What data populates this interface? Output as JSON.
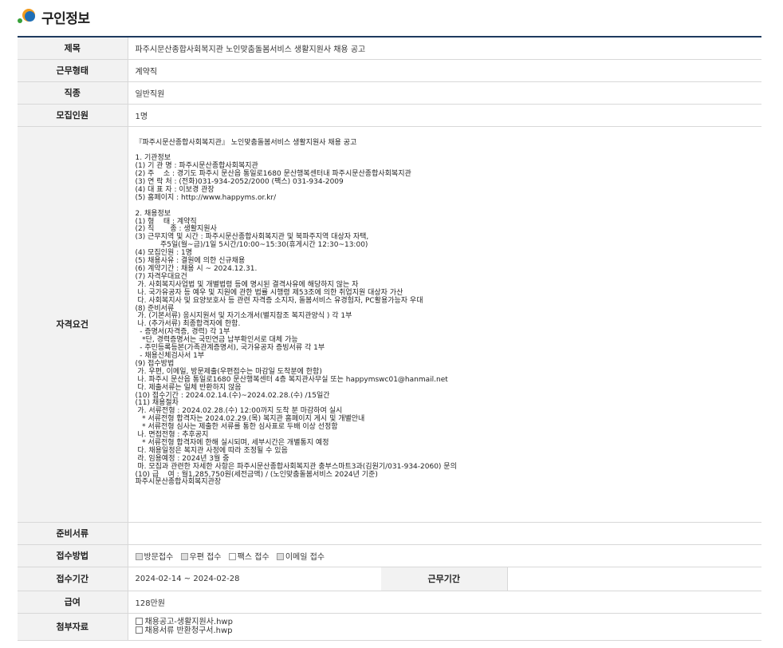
{
  "page": {
    "title": "구인정보"
  },
  "rows": {
    "subject": {
      "label": "제목",
      "value": "파주시문산종합사회복지관 노인맞춤돌봄서비스 생활지원사 채용 공고"
    },
    "employment_type": {
      "label": "근무형태",
      "value": "계약직"
    },
    "job_type": {
      "label": "직종",
      "value": "일반직원"
    },
    "headcount": {
      "label": "모집인원",
      "value": "1명"
    },
    "requirements": {
      "label": "자격요건",
      "text": "『파주시문산종합사회복지관』 노인맞춤돌봄서비스 생활지원사 채용 공고\n\n1. 기관정보\n(1) 기 관 명 : 파주시문산종합사회복지관\n(2) 주    소 : 경기도 파주시 문산읍 통일로1680 문산행복센터내 파주시문산종합사회복지관\n(3) 연 락 처 : (전화)031-934-2052/2000 (팩스) 031-934-2009\n(4) 대 표 자 : 이보경 관장\n(5) 홈페이지 : http://www.happyms.or.kr/\n\n2. 채용정보\n(1) 형    태 : 계약직\n(2) 직       종 : 생활지원사\n(3) 근무지역 및 시간 : 파주시문산종합사회복지관 및 북파주지역 대상자 자택,\n           주5일(월~금)/1일 5시간/10:00~15:30(휴게시간 12:30~13:00)\n(4) 모집인원 : 1명\n(5) 채용사유 : 결원에 의한 신규채용\n(6) 계약기간 : 채용 시 ~ 2024.12.31.\n(7) 자격우대요건\n 가. 사회복지사업법 및 개별법령 등에 명시된 결격사유에 해당하지 않는 자\n 나. 국가유공자 등 예우 및 지원에 관한 법률 시행령 제53조에 의한 취업지원 대상자 가산\n 다. 사회복지사 및 요양보호사 등 관련 자격증 소지자, 돌봄서비스 유경험자, PC활용가능자 우대\n(8) 준비서류\n 가. (기본서류) 응시지원서 및 자기소개서(별지참조 복지관양식 ) 각 1부\n 나. (추가서류) 최종합격자에 한함.\n  - 증명서(자격증, 경력) 각 1부\n   *단, 경력증명서는 국민연금 납부확인서로 대체 가능\n  - 주민등록등본(가족관계증명서), 국가유공자 증빙서류 각 1부\n  - 채용신체검사서 1부\n(9) 접수방법\n 가. 우편, 이메일, 방문제출(우편접수는 마감일 도착분에 한함)\n 나. 파주시 문산읍 통일로1680 문산행복센터 4층 복지관사무실 또는 happymswc01@hanmail.net\n 다. 제출서류는 일체 반환하지 않음\n(10) 접수기간 : 2024.02.14.(수)~2024.02.28.(수) /15일간\n(11) 채용절차\n 가. 서류전형 : 2024.02.28.(수) 12:00까지 도착 분 마감하여 실시\n   * 서류전형 합격자는 2024.02.29.(목) 복지관 홈페이지 게시 및 개별안내\n   * 서류전형 심사는 제출한 서류를 통한 심사표로 두배 이상 선정함\n 나. 면접전형 : 추후공지\n   * 서류전형 합격자에 한해 실시되며, 세부시간은 개별통지 예정\n 다. 채용일정은 복지관 사정에 따라 조정될 수 있음\n 라. 임용예정 : 2024년 3월 중\n 마. 모집과 관련한 자세한 사항은 파주시문산종합사회복지관 충부스마트3과(김원기/031-934-2060) 문의\n(10) 급    여 : 월1,285,750원(세전금액) / (노인맞춤돌봄서비스 2024년 기준)\n파주시문산종합사회복지관장"
    },
    "documents": {
      "label": "준비서류",
      "value": ""
    },
    "method": {
      "label": "접수방법",
      "options": [
        {
          "label": "방문접수",
          "checked": true
        },
        {
          "label": "우편 접수",
          "checked": true
        },
        {
          "label": "팩스 접수",
          "checked": false
        },
        {
          "label": "이메일 접수",
          "checked": true
        }
      ]
    },
    "period": {
      "label": "접수기간",
      "value": "2024-02-14 ~ 2024-02-28",
      "work_label": "근무기간",
      "work_value": ""
    },
    "salary": {
      "label": "급여",
      "value": "128만원"
    },
    "attachments": {
      "label": "첨부자료",
      "files": [
        "채용공고-생활지원사.hwp",
        "채용서류 반환청구서.hwp"
      ]
    }
  }
}
